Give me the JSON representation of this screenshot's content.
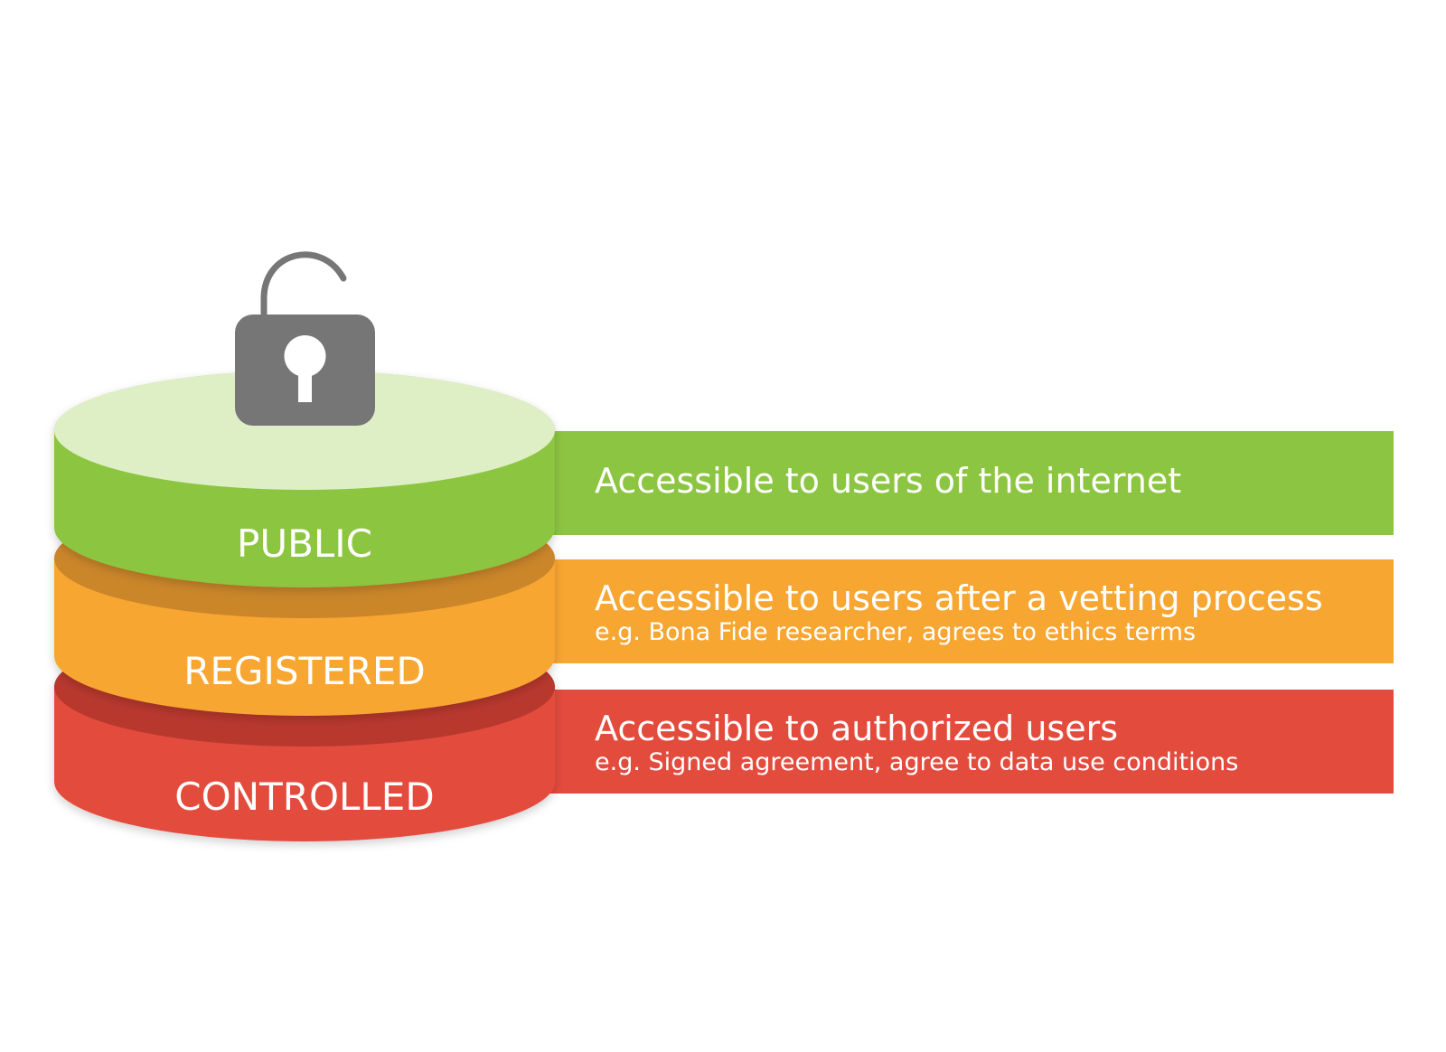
{
  "tiers": [
    {
      "id": "public",
      "label": "PUBLIC",
      "description": "Accessible to users of the internet",
      "detail": "",
      "color": "#8cc541",
      "top_color": "#deefc6"
    },
    {
      "id": "registered",
      "label": "REGISTERED",
      "description": "Accessible to users after a vetting process",
      "detail": "e.g. Bona Fide researcher, agrees to ethics terms",
      "color": "#f8a632",
      "rim_color": "#cb862c"
    },
    {
      "id": "controlled",
      "label": "CONTROLLED",
      "description": "Accessible to authorized users",
      "detail": "e.g. Signed agreement, agree to data use conditions",
      "color": "#e34b3d",
      "rim_color": "#b8392f"
    }
  ],
  "icons": {
    "lock": "open-padlock-icon",
    "lock_color": "#767676"
  }
}
